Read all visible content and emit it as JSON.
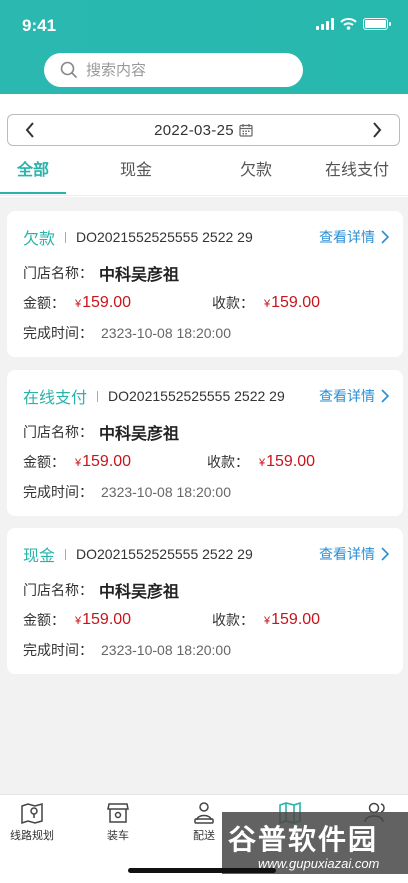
{
  "status": {
    "time": "9:41"
  },
  "search": {
    "placeholder": "搜索内容"
  },
  "date_bar": {
    "date": "2022-03-25"
  },
  "tabs": [
    {
      "label": "全部",
      "active": true
    },
    {
      "label": "现金",
      "active": false
    },
    {
      "label": "欠款",
      "active": false
    },
    {
      "label": "在线支付",
      "active": false
    }
  ],
  "orders": [
    {
      "type": "欠款",
      "order_no": "DO2021552525555 2522 29",
      "store_label": "门店名称：",
      "store": "中科吴彦祖",
      "amount_label": "金额：",
      "amount": "159.00",
      "received_label": "收款：",
      "received": "159.00",
      "time_label": "完成时间：",
      "time": "2323-10-08 18:20:00",
      "detail": "查看详情"
    },
    {
      "type": "在线支付",
      "order_no": "DO2021552525555 2522 29",
      "store_label": "门店名称：",
      "store": "中科吴彦祖",
      "amount_label": "金额：",
      "amount": "159.00",
      "received_label": "收款：",
      "received": "159.00",
      "time_label": "完成时间：",
      "time": "2323-10-08 18:20:00",
      "detail": "查看详情"
    },
    {
      "type": "现金",
      "order_no": "DO2021552525555 2522 29",
      "store_label": "门店名称：",
      "store": "中科吴彦祖",
      "amount_label": "金额：",
      "amount": "159.00",
      "received_label": "收款：",
      "received": "159.00",
      "time_label": "完成时间：",
      "time": "2323-10-08 18:20:00",
      "detail": "查看详情"
    }
  ],
  "currency": "¥",
  "nav": [
    {
      "label": "线路规划",
      "icon": "route-map-icon"
    },
    {
      "label": "装车",
      "icon": "store-pin-icon"
    },
    {
      "label": "配送",
      "icon": "courier-icon"
    },
    {
      "label": "",
      "icon": "map-fold-icon"
    },
    {
      "label": "",
      "icon": "users-icon"
    }
  ],
  "watermark": {
    "text": "谷普软件园",
    "url": "www.gupuxiazai.com"
  },
  "colors": {
    "brand": "#2ab3ab",
    "price": "#c8141c",
    "link": "#2a8fd6"
  }
}
